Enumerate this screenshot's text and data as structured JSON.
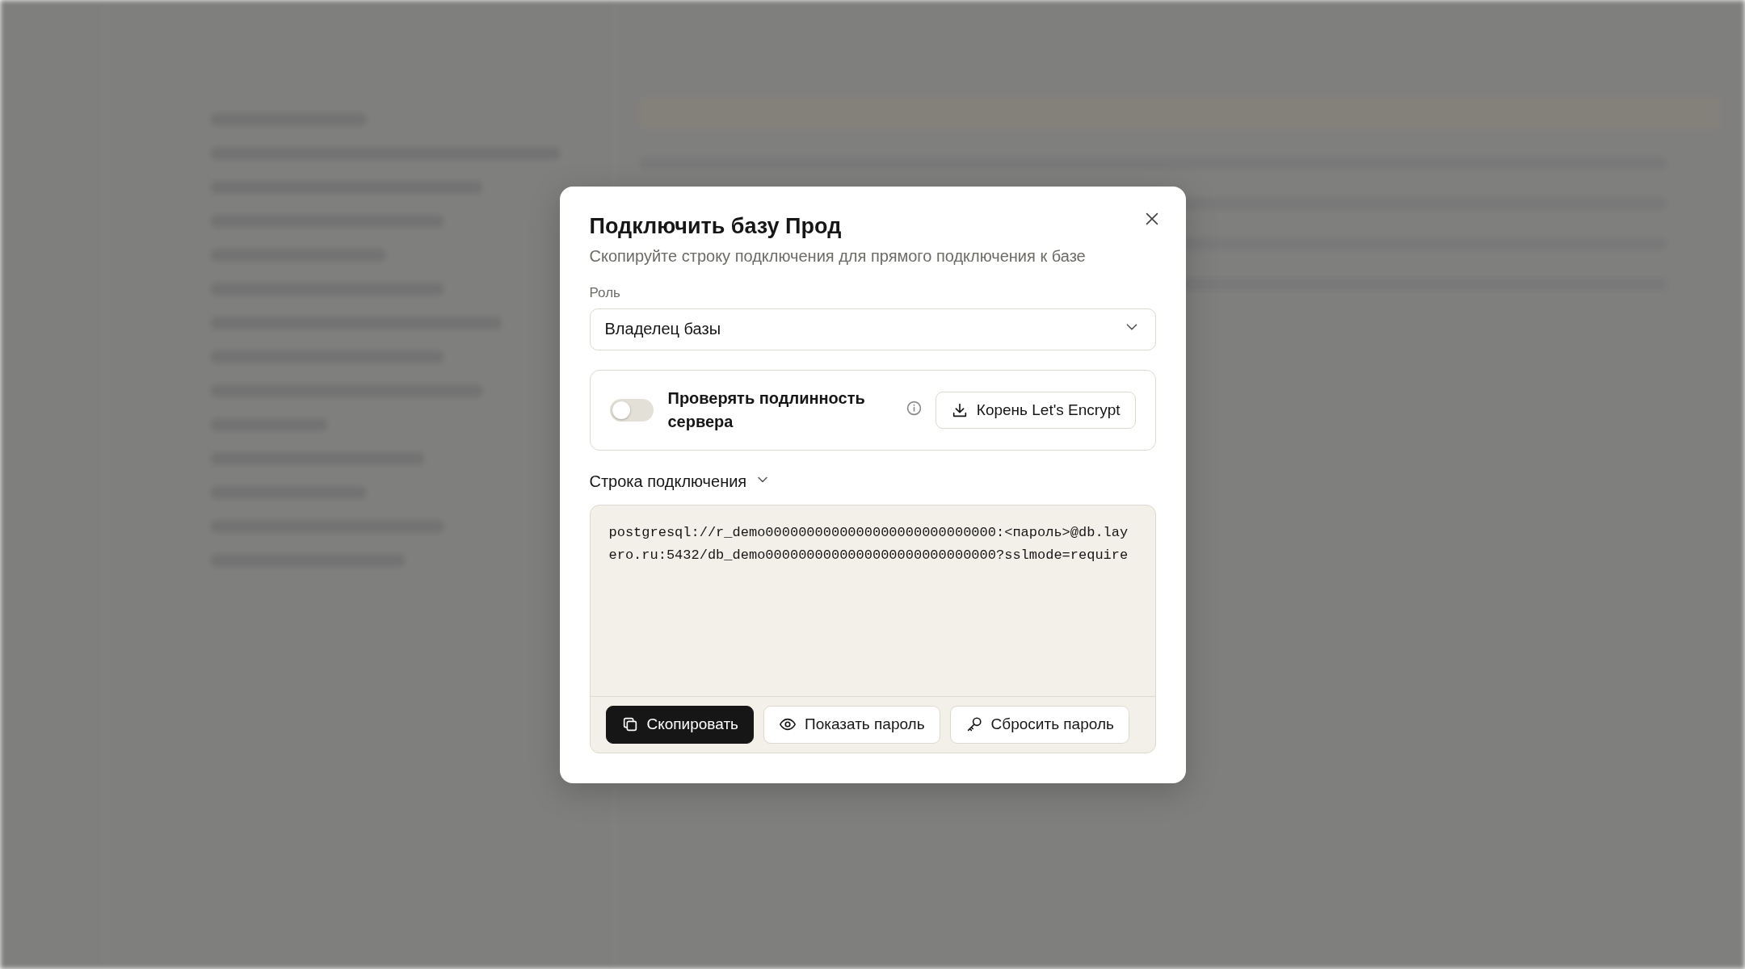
{
  "dialog": {
    "title": "Подключить базу Прод",
    "subtitle": "Скопируйте строку подключения для прямого подключения к базе",
    "role": {
      "label": "Роль",
      "value": "Владелец базы"
    },
    "verify": {
      "label": "Проверять подлинность сервера",
      "on": false,
      "download_button": "Корень Let's Encrypt"
    },
    "connection": {
      "label": "Строка подключения",
      "value": "postgresql://r_demo0000000000000000000000000000:<пароль>@db.layero.ru:5432/db_demo0000000000000000000000000000?sslmode=require",
      "buttons": [
        {
          "label": "Скопировать",
          "kind": "copy",
          "primary": true
        },
        {
          "label": "Показать пароль",
          "kind": "reveal",
          "primary": false
        },
        {
          "label": "Сбросить пароль",
          "kind": "reset",
          "primary": false
        }
      ]
    }
  }
}
